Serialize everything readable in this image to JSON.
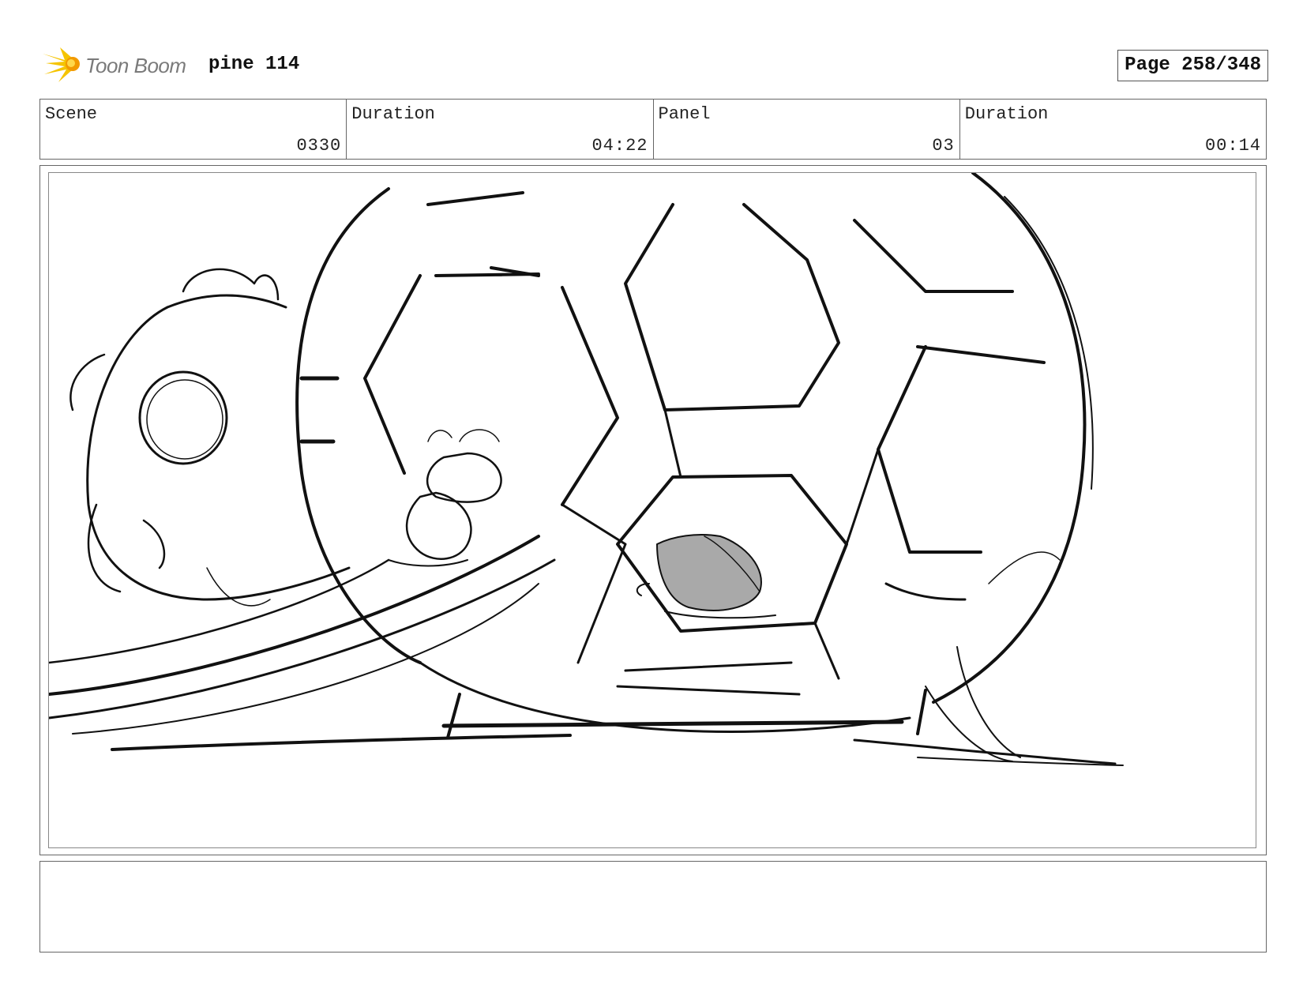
{
  "header": {
    "logo_text": "Toon Boom",
    "project_title": "pine 114",
    "page_label": "Page 258/348"
  },
  "info": {
    "scene_label": "Scene",
    "scene_value": "0330",
    "duration_label": "Duration",
    "duration_value": "04:22",
    "panel_label": "Panel",
    "panel_value": "03",
    "panel_duration_label": "Duration",
    "panel_duration_value": "00:14"
  },
  "panel": {
    "drawing": "storyboard-sketch",
    "icon": "sketch-artwork"
  },
  "notes": {
    "text": ""
  },
  "colors": {
    "logo_yellow": "#f5c400",
    "logo_orange": "#f29a00",
    "border": "#666666"
  }
}
